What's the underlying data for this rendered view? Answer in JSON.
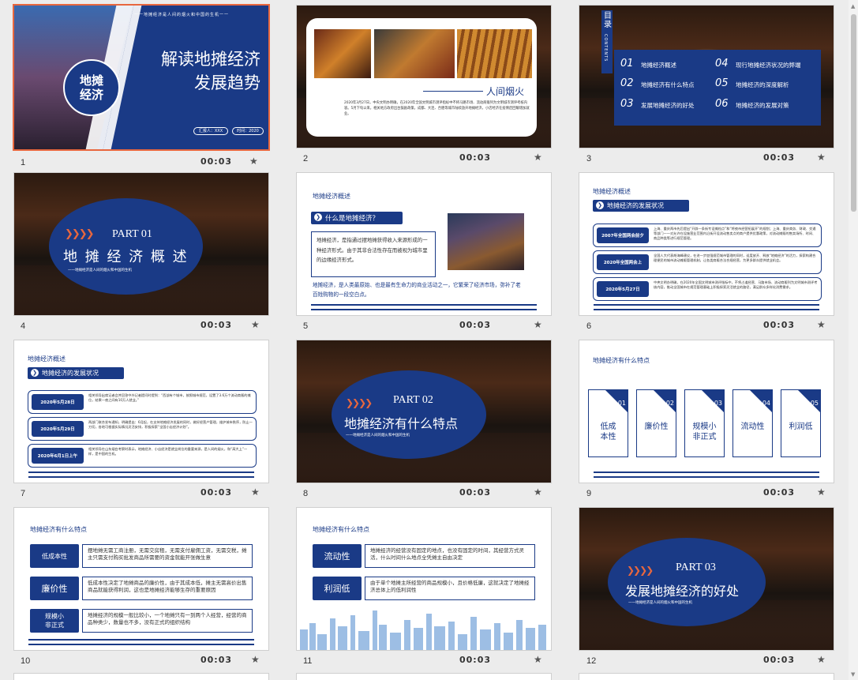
{
  "slides": [
    {
      "num": "1",
      "duration": "00:03",
      "title_line1": "解读地摊经济",
      "title_line2": "发展趋势",
      "badge": "地摊\n经济",
      "tagline": "一一地摊经济是人间的烟火和中国的生机一一",
      "reporter": "汇报人：XXX",
      "time": "时间：2020"
    },
    {
      "num": "2",
      "duration": "00:03",
      "heading": "人间烟火",
      "body": "2020年3月27日，中央文明办明确，在2020年全国文明城市测评指标中不将马路市场、流动商贩列为文明城市测评考核内容。5月下旬以来，相关地方政府出台鼓励政策，成都、大连、合肥等城市陆续放开地摊经济，小店经济在疫情后回暖增加就业。"
    },
    {
      "num": "3",
      "duration": "00:03",
      "toc_label": "目录",
      "toc_en": "CONTENTS",
      "items": [
        {
          "no": "01",
          "text": "地摊经济概述"
        },
        {
          "no": "04",
          "text": "现行地摊经济状况的弊端"
        },
        {
          "no": "02",
          "text": "地摊经济有什么特点"
        },
        {
          "no": "05",
          "text": "地摊经济的深度解析"
        },
        {
          "no": "03",
          "text": "发展地摊经济的好处"
        },
        {
          "no": "06",
          "text": "地摊经济的发展对策"
        }
      ]
    },
    {
      "num": "4",
      "duration": "00:03",
      "part": "PART 01",
      "title": "地 摊 经 济 概 述",
      "tagline": "一一地摊经济是人间的烟火和中国的生机"
    },
    {
      "num": "5",
      "duration": "00:03",
      "section": "地摊经济概述",
      "question": "什么是地摊经济？",
      "definition": "地摊经济，是指通过摆地摊获得收入来源形成的一种经济形式。由于其非合法性存在而被视为城市里的边缘经济形式。",
      "note": "地摊经济，是人类最原始、也是最有生命力的商业活动之一，它繁荣了经济市场，弥补了老百姓购物的一段空白点。"
    },
    {
      "num": "6",
      "duration": "00:03",
      "section": "地摊经济概述",
      "head": "地摊经济的发展状况",
      "rows": [
        {
          "label": "2007年全国两会前夕",
          "text": "上海、重庆两市先后提出“开辟一条街专设摊档点”和“将夜市经营拓展开”的规划；上海、重庆商务、财政、交通等部门一一对允许在设施营业范围内沿街开设流动售卖点的商户提供优惠政策，对流动摊贩的售卖场所、时间、商品种类等进行规范管理。"
        },
        {
          "label": "2020年全国两会上",
          "text": "全国人大代表胡海峰建议，在进一步加强规范城市管理的同时，适度放开、释放“地摊经济”的活力，探索构建合理便民的城市流动摊贩管理机制，让各类商贩合法合规经营，为更多群众提供就业机会。"
        },
        {
          "label": "2020年5月27日",
          "text": "中央文明办明确，在2020年全国文明城市测评指标中，不将占道经营、马路市场、流动商贩列为文明城市测评考核内容，推动全国城市在规范管理基础上积极探索灵活就业的路径，满足群众多样化消费需求。"
        }
      ]
    },
    {
      "num": "7",
      "duration": "00:03",
      "section": "地摊经济概述",
      "head": "地摊经济的发展状况",
      "rows": [
        {
          "label": "2020年5月28日",
          "text": "相关领导出席记者会并回答中外记者提问时提到：“西部有个城市，按照城市规范，设置了3.6万个流动商贩的摊位，结果一夜之间有10万人就业。”"
        },
        {
          "label": "2020年5月29日",
          "text": "两部门联合发布通知，明确提出：6月起，在支持地摊经济发展的同时，做好经营户管理，维护城市秩序，防止一刀切，各地可根据实际情况灵活安排，积极探索“全国小店经济计划”。"
        },
        {
          "label": "2020年6月1日上午",
          "text": "相关领导在山东烟台考察时表示，地摊经济、小店经济是就业岗位的重要来源，是人间的烟火，和“高大上”一样，是中国的生机。"
        }
      ]
    },
    {
      "num": "8",
      "duration": "00:03",
      "part": "PART 02",
      "title": "地摊经济有什么特点",
      "tagline": "一一地摊经济是人间的烟火和中国的生机"
    },
    {
      "num": "9",
      "duration": "00:03",
      "section": "地摊经济有什么特点",
      "cards": [
        {
          "no": "01",
          "text": "低成\n本性"
        },
        {
          "no": "02",
          "text": "廉价性"
        },
        {
          "no": "03",
          "text": "规模小\n非正式"
        },
        {
          "no": "04",
          "text": "流动性"
        },
        {
          "no": "05",
          "text": "利润低"
        }
      ]
    },
    {
      "num": "10",
      "duration": "00:03",
      "section": "地摊经济有什么特点",
      "features": [
        {
          "label": "低成本性",
          "text": "摆地摊无需工商注册，无需交房租，无需支付雇佣工资，无需交税，摊主只需支付购买批发商品所需要的资金就能开张做生意"
        },
        {
          "label": "廉价性",
          "text": "低成本性决定了地摊商品的廉价性，由于其成本低，摊主无需高价出售商品就能获得利润，这也是地摊经济能够生存的重要原因"
        },
        {
          "label": "规模小\n非正式",
          "text": "地摊经济的规模一般比较小，一个地摊只有一到两个人经营，经营的商品种类少，数量也不多，没有正式的组织结构"
        }
      ]
    },
    {
      "num": "11",
      "duration": "00:03",
      "section": "地摊经济有什么特点",
      "features": [
        {
          "label": "流动性",
          "text": "地摊经济的经营没有固定的地点，也没有固定的时间，其经营方式灵活，什么时间什么地点全凭摊主自由决定"
        },
        {
          "label": "利润低",
          "text": "由于单个地摊主所经营的商品规模小，且价格低廉，这就决定了地摊经济总体上的低利润性"
        }
      ]
    },
    {
      "num": "12",
      "duration": "00:03",
      "part": "PART 03",
      "title": "发展地摊经济的好处",
      "tagline": "一一地摊经济是人间的烟火和中国的生机"
    }
  ],
  "colors": {
    "navy": "#1a3a86",
    "accent": "#e8673e"
  }
}
